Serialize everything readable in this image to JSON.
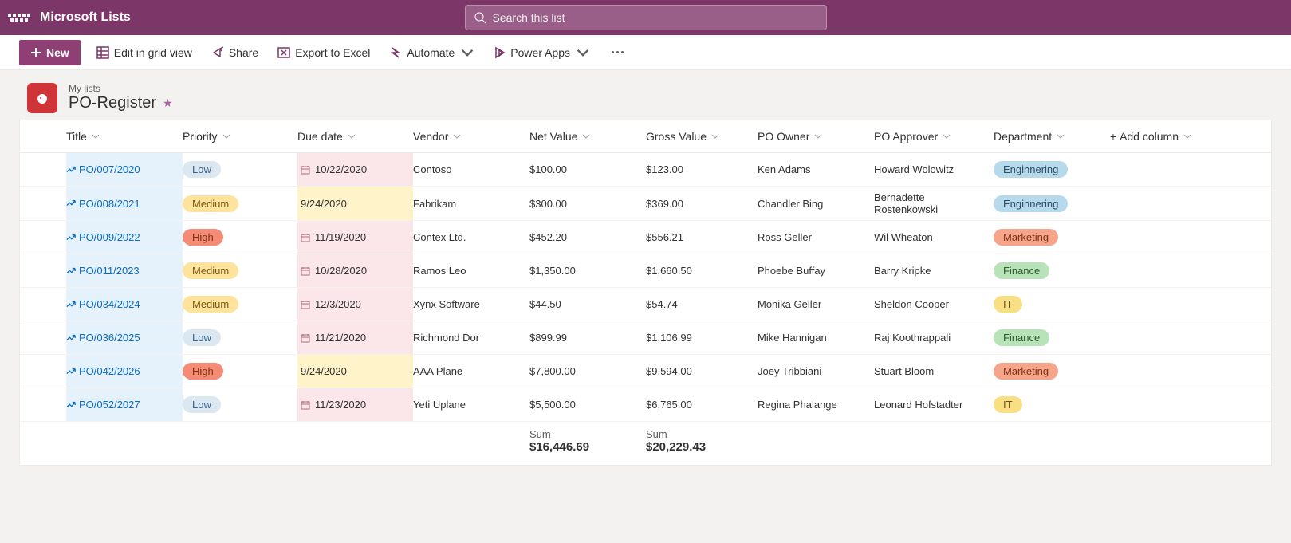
{
  "app": {
    "name": "Microsoft Lists"
  },
  "search": {
    "placeholder": "Search this list"
  },
  "commands": {
    "new": "New",
    "grid": "Edit in grid view",
    "share": "Share",
    "export": "Export to Excel",
    "automate": "Automate",
    "powerapps": "Power Apps"
  },
  "list": {
    "crumb": "My lists",
    "title": "PO-Register"
  },
  "columns": {
    "title": "Title",
    "priority": "Priority",
    "due": "Due date",
    "vendor": "Vendor",
    "net": "Net Value",
    "gross": "Gross Value",
    "owner": "PO Owner",
    "approver": "PO Approver",
    "dept": "Department",
    "add": "Add column"
  },
  "rows": [
    {
      "title": "PO/007/2020",
      "priority": "Low",
      "due": "10/22/2020",
      "dueColor": "pink",
      "dueIcon": true,
      "vendor": "Contoso",
      "net": "$100.00",
      "gross": "$123.00",
      "owner": "Ken Adams",
      "approver": "Howard Wolowitz",
      "dept": "Enginnering",
      "deptClass": "eng"
    },
    {
      "title": "PO/008/2021",
      "priority": "Medium",
      "due": "9/24/2020",
      "dueColor": "yellow",
      "dueIcon": false,
      "vendor": "Fabrikam",
      "net": "$300.00",
      "gross": "$369.00",
      "owner": "Chandler Bing",
      "approver": "Bernadette Rostenkowski",
      "dept": "Enginnering",
      "deptClass": "eng"
    },
    {
      "title": "PO/009/2022",
      "priority": "High",
      "due": "11/19/2020",
      "dueColor": "pink",
      "dueIcon": true,
      "vendor": "Contex Ltd.",
      "net": "$452.20",
      "gross": "$556.21",
      "owner": "Ross Geller",
      "approver": "Wil Wheaton",
      "dept": "Marketing",
      "deptClass": "mkt"
    },
    {
      "title": "PO/011/2023",
      "priority": "Medium",
      "due": "10/28/2020",
      "dueColor": "pink",
      "dueIcon": true,
      "vendor": "Ramos Leo",
      "net": "$1,350.00",
      "gross": "$1,660.50",
      "owner": "Phoebe Buffay",
      "approver": "Barry Kripke",
      "dept": "Finance",
      "deptClass": "fin"
    },
    {
      "title": "PO/034/2024",
      "priority": "Medium",
      "due": "12/3/2020",
      "dueColor": "pink",
      "dueIcon": true,
      "vendor": "Xynx Software",
      "net": "$44.50",
      "gross": "$54.74",
      "owner": "Monika Geller",
      "approver": "Sheldon Cooper",
      "dept": "IT",
      "deptClass": "it"
    },
    {
      "title": "PO/036/2025",
      "priority": "Low",
      "due": "11/21/2020",
      "dueColor": "pink",
      "dueIcon": true,
      "vendor": "Richmond Dor",
      "net": "$899.99",
      "gross": "$1,106.99",
      "owner": "Mike Hannigan",
      "approver": "Raj Koothrappali",
      "dept": "Finance",
      "deptClass": "fin"
    },
    {
      "title": "PO/042/2026",
      "priority": "High",
      "due": "9/24/2020",
      "dueColor": "yellow",
      "dueIcon": false,
      "vendor": "AAA Plane",
      "net": "$7,800.00",
      "gross": "$9,594.00",
      "owner": "Joey Tribbiani",
      "approver": "Stuart Bloom",
      "dept": "Marketing",
      "deptClass": "mkt"
    },
    {
      "title": "PO/052/2027",
      "priority": "Low",
      "due": "11/23/2020",
      "dueColor": "pink",
      "dueIcon": true,
      "vendor": "Yeti Uplane",
      "net": "$5,500.00",
      "gross": "$6,765.00",
      "owner": "Regina Phalange",
      "approver": "Leonard Hofstadter",
      "dept": "IT",
      "deptClass": "it"
    }
  ],
  "footer": {
    "net_label": "Sum",
    "net_value": "$16,446.69",
    "gross_label": "Sum",
    "gross_value": "$20,229.43"
  }
}
